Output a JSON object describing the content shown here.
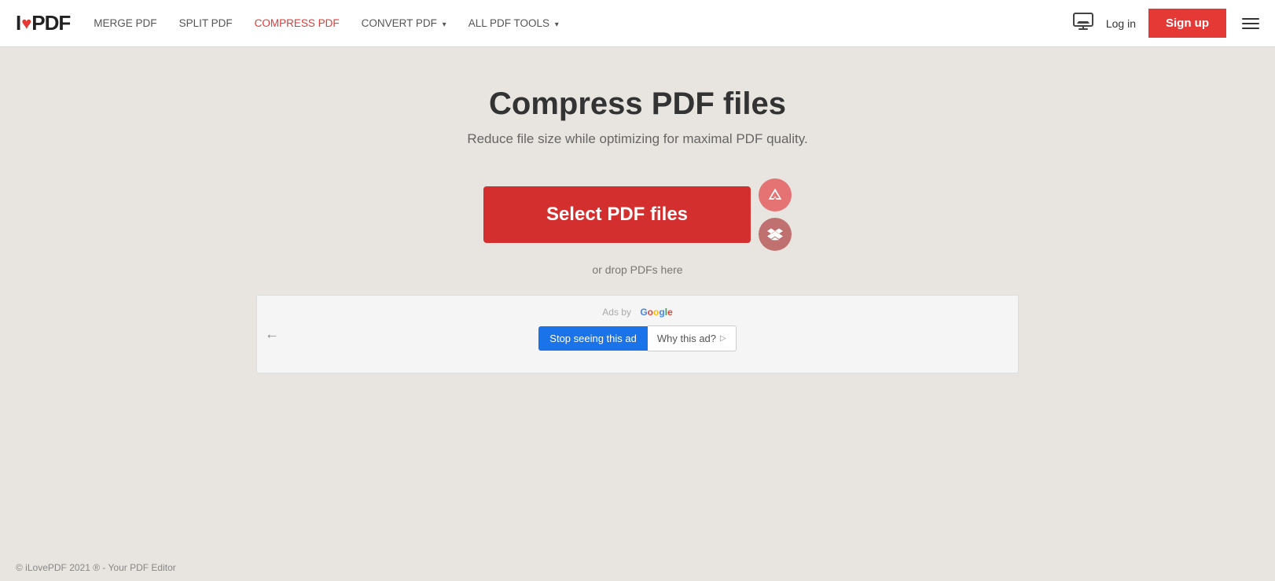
{
  "header": {
    "logo_i": "I",
    "logo_love": "❤",
    "logo_pdf": "PDF",
    "nav": [
      {
        "label": "MERGE PDF",
        "active": false,
        "has_arrow": false
      },
      {
        "label": "SPLIT PDF",
        "active": false,
        "has_arrow": false
      },
      {
        "label": "COMPRESS PDF",
        "active": true,
        "has_arrow": false
      },
      {
        "label": "CONVERT PDF",
        "active": false,
        "has_arrow": true
      },
      {
        "label": "ALL PDF TOOLS",
        "active": false,
        "has_arrow": true
      }
    ],
    "login_label": "Log in",
    "signup_label": "Sign up"
  },
  "main": {
    "title": "Compress PDF files",
    "subtitle": "Reduce file size while optimizing for maximal PDF quality.",
    "select_btn_label": "Select PDF files",
    "drop_text": "or drop PDFs here",
    "icon_google_drive": "▲",
    "icon_dropbox": "❖"
  },
  "ad": {
    "back_arrow": "←",
    "ads_by_label": "Ads by",
    "google_label": "Google",
    "stop_ad_label": "Stop seeing this ad",
    "why_ad_label": "Why this ad?",
    "why_ad_arrow": "▷"
  },
  "footer": {
    "copyright": "© iLovePDF 2021 ® - Your PDF Editor"
  }
}
